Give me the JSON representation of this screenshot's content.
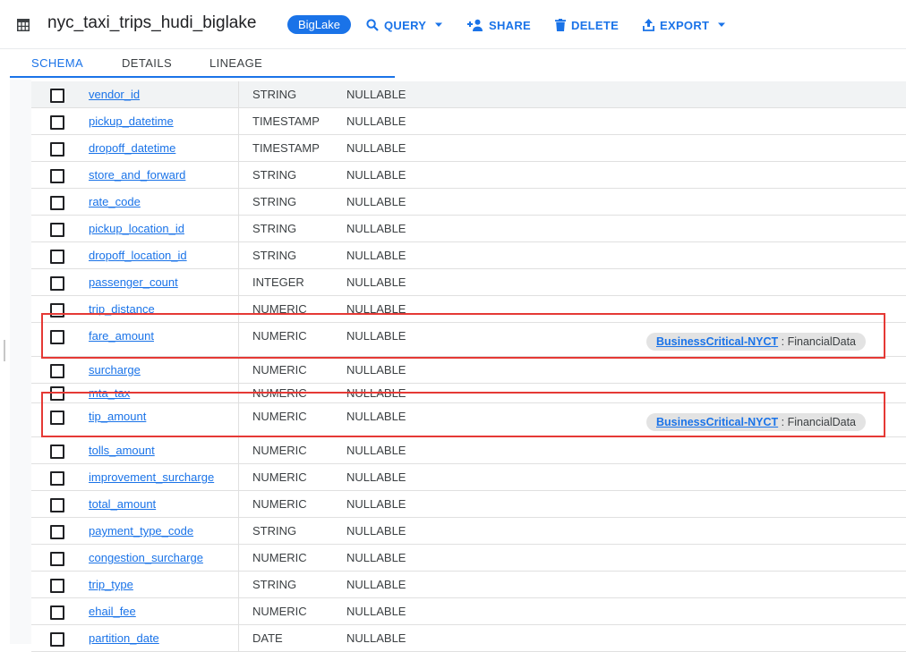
{
  "header": {
    "title": "nyc_taxi_trips_hudi_biglake",
    "badge": "BigLake",
    "actions": {
      "query": "QUERY",
      "share": "SHARE",
      "delete": "DELETE",
      "export": "EXPORT"
    }
  },
  "tabs": [
    {
      "label": "SCHEMA",
      "active": true
    },
    {
      "label": "DETAILS",
      "active": false
    },
    {
      "label": "LINEAGE",
      "active": false
    }
  ],
  "rows": [
    {
      "name": "vendor_id",
      "type": "STRING",
      "mode": "NULLABLE"
    },
    {
      "name": "pickup_datetime",
      "type": "TIMESTAMP",
      "mode": "NULLABLE"
    },
    {
      "name": "dropoff_datetime",
      "type": "TIMESTAMP",
      "mode": "NULLABLE"
    },
    {
      "name": "store_and_forward",
      "type": "STRING",
      "mode": "NULLABLE"
    },
    {
      "name": "rate_code",
      "type": "STRING",
      "mode": "NULLABLE"
    },
    {
      "name": "pickup_location_id",
      "type": "STRING",
      "mode": "NULLABLE"
    },
    {
      "name": "dropoff_location_id",
      "type": "STRING",
      "mode": "NULLABLE"
    },
    {
      "name": "passenger_count",
      "type": "INTEGER",
      "mode": "NULLABLE"
    },
    {
      "name": "trip_distance",
      "type": "NUMERIC",
      "mode": "NULLABLE"
    },
    {
      "name": "fare_amount",
      "type": "NUMERIC",
      "mode": "NULLABLE",
      "tag": {
        "key": "BusinessCritical-NYCT",
        "value": "FinancialData"
      }
    },
    {
      "name": "surcharge",
      "type": "NUMERIC",
      "mode": "NULLABLE"
    },
    {
      "name": "mta_tax",
      "type": "NUMERIC",
      "mode": "NULLABLE"
    },
    {
      "name": "tip_amount",
      "type": "NUMERIC",
      "mode": "NULLABLE",
      "tag": {
        "key": "BusinessCritical-NYCT",
        "value": "FinancialData"
      }
    },
    {
      "name": "tolls_amount",
      "type": "NUMERIC",
      "mode": "NULLABLE"
    },
    {
      "name": "improvement_surcharge",
      "type": "NUMERIC",
      "mode": "NULLABLE"
    },
    {
      "name": "total_amount",
      "type": "NUMERIC",
      "mode": "NULLABLE"
    },
    {
      "name": "payment_type_code",
      "type": "STRING",
      "mode": "NULLABLE"
    },
    {
      "name": "congestion_surcharge",
      "type": "NUMERIC",
      "mode": "NULLABLE"
    },
    {
      "name": "trip_type",
      "type": "STRING",
      "mode": "NULLABLE"
    },
    {
      "name": "ehail_fee",
      "type": "NUMERIC",
      "mode": "NULLABLE"
    },
    {
      "name": "partition_date",
      "type": "DATE",
      "mode": "NULLABLE"
    }
  ],
  "tag_separator": " : ",
  "colors": {
    "accent": "#1a73e8",
    "highlight": "#e53935",
    "tag_bg": "#e3e3e3"
  }
}
